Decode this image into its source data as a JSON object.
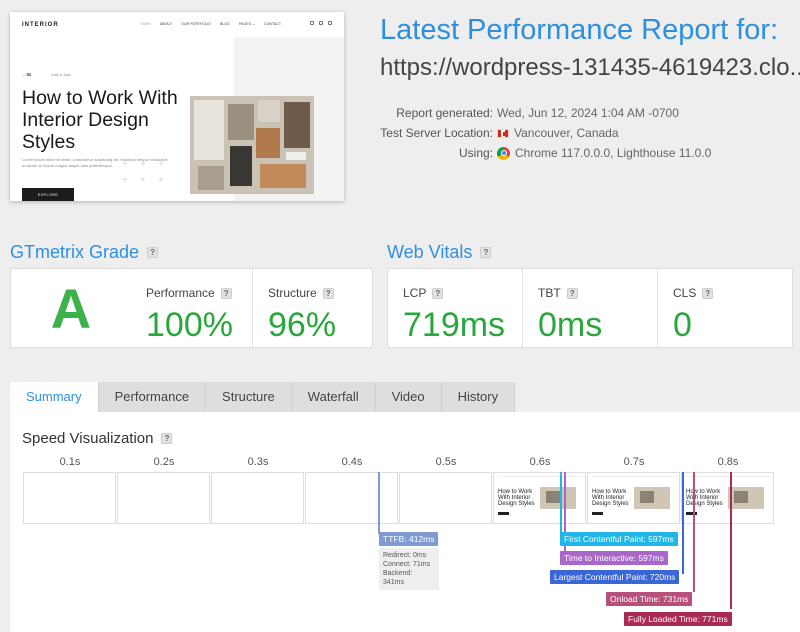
{
  "thumbnail": {
    "logo": "INTERIOR",
    "nav": [
      "HOME",
      "ABOUT",
      "OUR PORTFOLIO",
      "BLOG",
      "PAGES ⌄",
      "CONTACT"
    ],
    "kicker_num": "01",
    "kicker_text": "Kate & Jack",
    "headline": "How to Work With Interior Design Styles",
    "body": "Lorem ipsum dolor sit amet, consectetur adipiscing elit, eiusmod tempor incididunt ut labore et dolore magna aliqua odio pellentesque",
    "button": "EXPLORE"
  },
  "report": {
    "title": "Latest Performance Report for:",
    "url": "https://wordpress-131435-4619423.clo...",
    "generated_label": "Report generated:",
    "generated_value": "Wed, Jun 12, 2024 1:04 AM -0700",
    "location_label": "Test Server Location:",
    "location_value": "Vancouver, Canada",
    "using_label": "Using:",
    "using_value": "Chrome 117.0.0.0, Lighthouse 11.0.0"
  },
  "grade": {
    "title": "GTmetrix Grade",
    "help": "?",
    "letter": "A",
    "performance_label": "Performance",
    "performance_value": "100%",
    "structure_label": "Structure",
    "structure_value": "96%"
  },
  "vitals": {
    "title": "Web Vitals",
    "help": "?",
    "lcp_label": "LCP",
    "lcp_value": "719ms",
    "tbt_label": "TBT",
    "tbt_value": "0ms",
    "cls_label": "CLS",
    "cls_value": "0"
  },
  "tabs": [
    "Summary",
    "Performance",
    "Structure",
    "Waterfall",
    "Video",
    "History"
  ],
  "active_tab": "Summary",
  "speed": {
    "title": "Speed Visualization",
    "ticks": [
      "0.1s",
      "0.2s",
      "0.3s",
      "0.4s",
      "0.5s",
      "0.6s",
      "0.7s",
      "0.8s"
    ],
    "frame_text": "How to Work With Interior Design Styles",
    "ttfb": "TTFB: 412ms",
    "ttfb_redirect": "Redirect: 0ms",
    "ttfb_connect": "Connect: 71ms",
    "ttfb_backend": "Backend: 341ms",
    "fcp": "First Contentful Paint: 597ms",
    "tti": "Time to Interactive: 597ms",
    "lcp": "Largest Contentful Paint: 720ms",
    "onload": "Onload Time: 731ms",
    "fully_loaded": "Fully Loaded Time: 771ms"
  },
  "colors": {
    "accent": "#2e8fe1",
    "good": "#2aa73c",
    "ttfb": "#7f9ad0",
    "fcp": "#22b6e8",
    "tti": "#a868c9",
    "lcp": "#3b66d6",
    "onload": "#b7507b",
    "fully_loaded": "#a82a55"
  }
}
